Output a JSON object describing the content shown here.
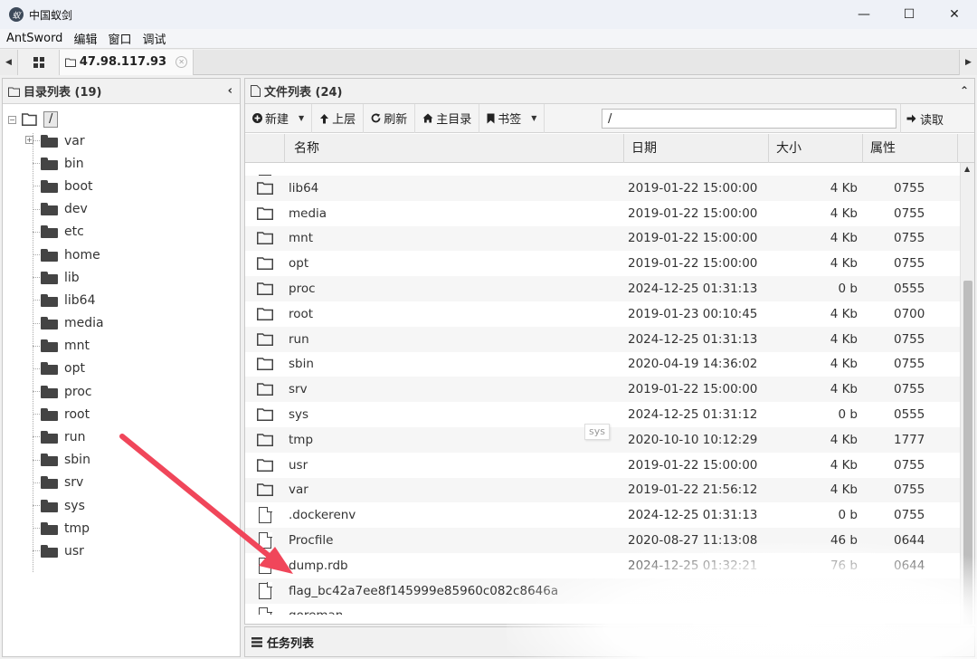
{
  "window": {
    "title": "中国蚁剑",
    "app_icon_glyph": "蚁",
    "controls": {
      "minimize": "—",
      "maximize": "☐",
      "close": "✕"
    }
  },
  "menu": [
    "AntSword",
    "编辑",
    "窗口",
    "调试"
  ],
  "tabs": {
    "home_icon": "grid-icon",
    "host": "47.98.117.93",
    "close": "✕",
    "left_arrow": "◀",
    "right_arrow": "▶"
  },
  "left_panel": {
    "title": "目录列表 (19)",
    "collapse": "‹",
    "root": {
      "toggle": "−",
      "label": "/"
    },
    "items": [
      {
        "label": "var",
        "expandable": true
      },
      {
        "label": "bin"
      },
      {
        "label": "boot"
      },
      {
        "label": "dev"
      },
      {
        "label": "etc"
      },
      {
        "label": "home"
      },
      {
        "label": "lib"
      },
      {
        "label": "lib64"
      },
      {
        "label": "media"
      },
      {
        "label": "mnt"
      },
      {
        "label": "opt"
      },
      {
        "label": "proc"
      },
      {
        "label": "root"
      },
      {
        "label": "run"
      },
      {
        "label": "sbin"
      },
      {
        "label": "srv"
      },
      {
        "label": "sys"
      },
      {
        "label": "tmp"
      },
      {
        "label": "usr"
      }
    ]
  },
  "right_panel": {
    "title": "文件列表 (24)",
    "collapse": "⌃",
    "toolbar": {
      "new": "新建",
      "up": "上层",
      "refresh": "刷新",
      "home": "主目录",
      "bookmark": "书签",
      "path_value": "/",
      "read": "读取"
    },
    "columns": {
      "name": "名称",
      "date": "日期",
      "size": "大小",
      "attr": "属性"
    },
    "rows": [
      {
        "type": "dir",
        "name": "lib64",
        "date": "2019-01-22 15:00:00",
        "size": "4 Kb",
        "attr": "0755"
      },
      {
        "type": "dir",
        "name": "media",
        "date": "2019-01-22 15:00:00",
        "size": "4 Kb",
        "attr": "0755"
      },
      {
        "type": "dir",
        "name": "mnt",
        "date": "2019-01-22 15:00:00",
        "size": "4 Kb",
        "attr": "0755"
      },
      {
        "type": "dir",
        "name": "opt",
        "date": "2019-01-22 15:00:00",
        "size": "4 Kb",
        "attr": "0755"
      },
      {
        "type": "dir",
        "name": "proc",
        "date": "2024-12-25 01:31:13",
        "size": "0 b",
        "attr": "0555"
      },
      {
        "type": "dir",
        "name": "root",
        "date": "2019-01-23 00:10:45",
        "size": "4 Kb",
        "attr": "0700"
      },
      {
        "type": "dir",
        "name": "run",
        "date": "2024-12-25 01:31:13",
        "size": "4 Kb",
        "attr": "0755"
      },
      {
        "type": "dir",
        "name": "sbin",
        "date": "2020-04-19 14:36:02",
        "size": "4 Kb",
        "attr": "0755"
      },
      {
        "type": "dir",
        "name": "srv",
        "date": "2019-01-22 15:00:00",
        "size": "4 Kb",
        "attr": "0755"
      },
      {
        "type": "dir",
        "name": "sys",
        "date": "2024-12-25 01:31:12",
        "size": "0 b",
        "attr": "0555"
      },
      {
        "type": "dir",
        "name": "tmp",
        "date": "2020-10-10 10:12:29",
        "size": "4 Kb",
        "attr": "1777"
      },
      {
        "type": "dir",
        "name": "usr",
        "date": "2019-01-22 15:00:00",
        "size": "4 Kb",
        "attr": "0755"
      },
      {
        "type": "dir",
        "name": "var",
        "date": "2019-01-22 21:56:12",
        "size": "4 Kb",
        "attr": "0755"
      },
      {
        "type": "file",
        "name": ".dockerenv",
        "date": "2024-12-25 01:31:13",
        "size": "0 b",
        "attr": "0755"
      },
      {
        "type": "file",
        "name": "Procfile",
        "date": "2020-08-27 11:13:08",
        "size": "46 b",
        "attr": "0644"
      },
      {
        "type": "file",
        "name": "dump.rdb",
        "date": "2024-12-25 01:32:21",
        "size": "76 b",
        "attr": "0644"
      },
      {
        "type": "file",
        "name": "flag_bc42a7ee8f145999e85960c082c8646a",
        "date": "",
        "size": "",
        "attr": ""
      },
      {
        "type": "file",
        "name": "goreman",
        "date": "",
        "size": "",
        "attr": ""
      }
    ],
    "tooltip": "sys",
    "scroll_up": "▲"
  },
  "task_panel": {
    "title": "任务列表"
  },
  "colors": {
    "arrow": "#f0465a",
    "icon": "#444444"
  }
}
